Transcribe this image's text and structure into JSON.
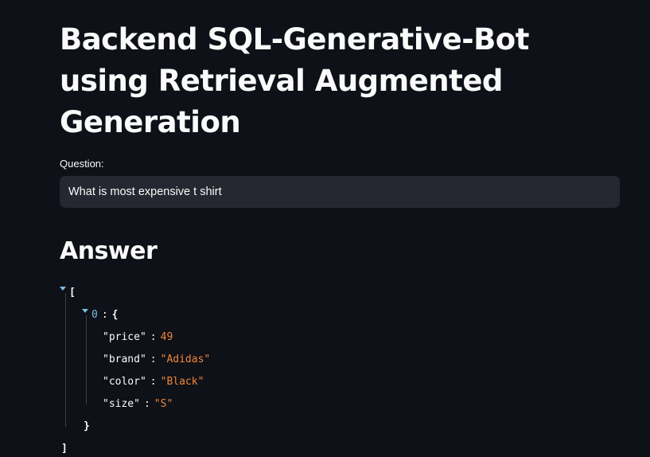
{
  "page": {
    "title": "Backend SQL-Generative-Bot using Retrieval Augmented Generation"
  },
  "question": {
    "label": "Question:",
    "value": "What is most expensive t shirt"
  },
  "answer": {
    "heading": "Answer",
    "open_bracket": "[",
    "close_bracket": "]",
    "items": [
      {
        "index": "0",
        "open_brace": "{",
        "close_brace": "}",
        "fields": [
          {
            "key": "\"price\"",
            "value": "49"
          },
          {
            "key": "\"brand\"",
            "value": "\"Adidas\""
          },
          {
            "key": "\"color\"",
            "value": "\"Black\""
          },
          {
            "key": "\"size\"",
            "value": "\"S\""
          }
        ]
      }
    ]
  },
  "colors": {
    "background": "#0e1117",
    "input_background": "#262730",
    "json_value": "#f0863a",
    "json_index": "#7fbbdf"
  }
}
